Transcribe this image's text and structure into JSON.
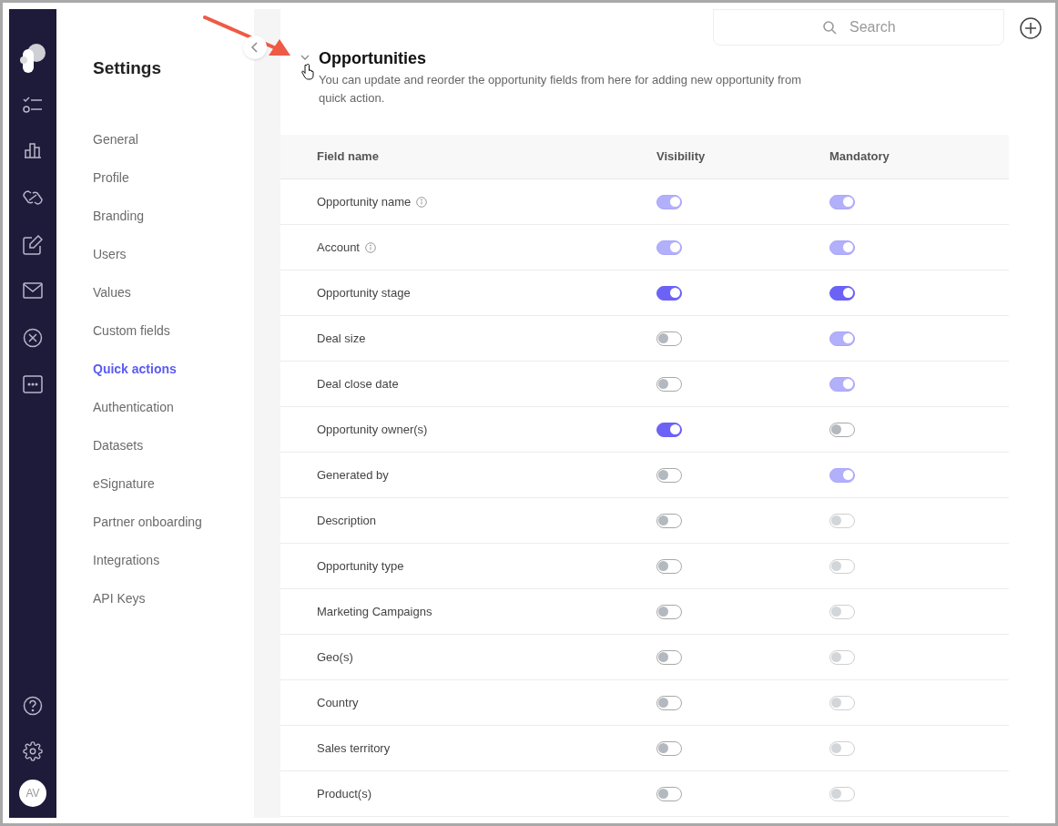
{
  "sidebar": {
    "title": "Settings",
    "items": [
      {
        "label": "General",
        "selected": false
      },
      {
        "label": "Profile",
        "selected": false
      },
      {
        "label": "Branding",
        "selected": false
      },
      {
        "label": "Users",
        "selected": false
      },
      {
        "label": "Values",
        "selected": false
      },
      {
        "label": "Custom fields",
        "selected": false
      },
      {
        "label": "Quick actions",
        "selected": true
      },
      {
        "label": "Authentication",
        "selected": false
      },
      {
        "label": "Datasets",
        "selected": false
      },
      {
        "label": "eSignature",
        "selected": false
      },
      {
        "label": "Partner onboarding",
        "selected": false
      },
      {
        "label": "Integrations",
        "selected": false
      },
      {
        "label": "API Keys",
        "selected": false
      }
    ]
  },
  "rail": {
    "avatar": "AV"
  },
  "search": {
    "placeholder": "Search"
  },
  "section": {
    "title": "Opportunities",
    "expanded": true,
    "description": "You can update and reorder the opportunity fields from here for adding new opportunity from quick action."
  },
  "table": {
    "columns": [
      "Field name",
      "Visibility",
      "Mandatory"
    ],
    "rows": [
      {
        "name": "Opportunity name",
        "info": true,
        "visibility": {
          "on": true,
          "disabled": true
        },
        "mandatory": {
          "on": true,
          "disabled": true
        }
      },
      {
        "name": "Account",
        "info": true,
        "visibility": {
          "on": true,
          "disabled": true
        },
        "mandatory": {
          "on": true,
          "disabled": true
        }
      },
      {
        "name": "Opportunity stage",
        "info": false,
        "visibility": {
          "on": true,
          "disabled": false
        },
        "mandatory": {
          "on": true,
          "disabled": false
        }
      },
      {
        "name": "Deal size",
        "info": false,
        "visibility": {
          "on": false,
          "disabled": false
        },
        "mandatory": {
          "on": true,
          "disabled": true
        }
      },
      {
        "name": "Deal close date",
        "info": false,
        "visibility": {
          "on": false,
          "disabled": false
        },
        "mandatory": {
          "on": true,
          "disabled": true
        }
      },
      {
        "name": "Opportunity owner(s)",
        "info": false,
        "visibility": {
          "on": true,
          "disabled": false
        },
        "mandatory": {
          "on": false,
          "disabled": false
        }
      },
      {
        "name": "Generated by",
        "info": false,
        "visibility": {
          "on": false,
          "disabled": false
        },
        "mandatory": {
          "on": true,
          "disabled": true
        }
      },
      {
        "name": "Description",
        "info": false,
        "visibility": {
          "on": false,
          "disabled": false
        },
        "mandatory": {
          "on": false,
          "disabled": true
        }
      },
      {
        "name": "Opportunity type",
        "info": false,
        "visibility": {
          "on": false,
          "disabled": false
        },
        "mandatory": {
          "on": false,
          "disabled": true
        }
      },
      {
        "name": "Marketing Campaigns",
        "info": false,
        "visibility": {
          "on": false,
          "disabled": false
        },
        "mandatory": {
          "on": false,
          "disabled": true
        }
      },
      {
        "name": "Geo(s)",
        "info": false,
        "visibility": {
          "on": false,
          "disabled": false
        },
        "mandatory": {
          "on": false,
          "disabled": true
        }
      },
      {
        "name": "Country",
        "info": false,
        "visibility": {
          "on": false,
          "disabled": false
        },
        "mandatory": {
          "on": false,
          "disabled": true
        }
      },
      {
        "name": "Sales territory",
        "info": false,
        "visibility": {
          "on": false,
          "disabled": false
        },
        "mandatory": {
          "on": false,
          "disabled": true
        }
      },
      {
        "name": "Product(s)",
        "info": false,
        "visibility": {
          "on": false,
          "disabled": false
        },
        "mandatory": {
          "on": false,
          "disabled": true
        }
      }
    ]
  }
}
